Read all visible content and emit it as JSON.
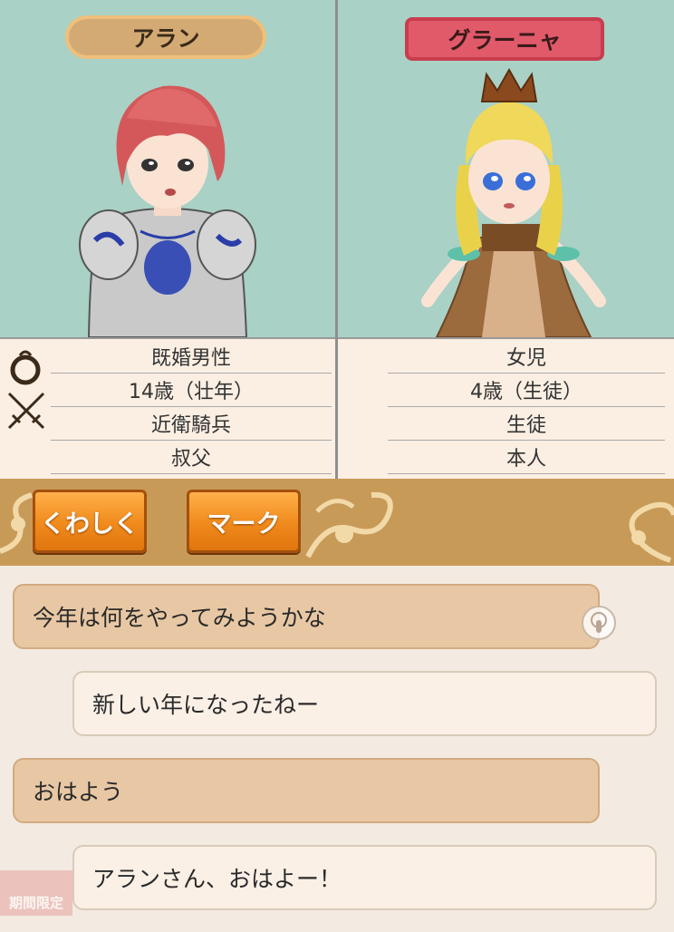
{
  "left_character": {
    "name": "アラン",
    "marital": "既婚男性",
    "age": "14歳（壮年）",
    "job": "近衛騎兵",
    "relation": "叔父"
  },
  "right_character": {
    "name": "グラーニャ",
    "marital": "女児",
    "age": "4歳（生徒）",
    "job": "生徒",
    "relation": "本人"
  },
  "buttons": {
    "detail": "くわしく",
    "mark": "マーク"
  },
  "chat": [
    {
      "side": "left",
      "text": "今年は何をやってみようかな"
    },
    {
      "side": "right",
      "text": "新しい年になったねー"
    },
    {
      "side": "left",
      "text": "おはよう"
    },
    {
      "side": "right",
      "text": "アランさん、おはよー！"
    }
  ],
  "badge": "期間限定",
  "colors": {
    "portrait_bg": "#a9d1c6",
    "name_tag_left": "#d4aa74",
    "name_tag_right": "#e05a6a",
    "button_orange": "#f08a1c"
  }
}
